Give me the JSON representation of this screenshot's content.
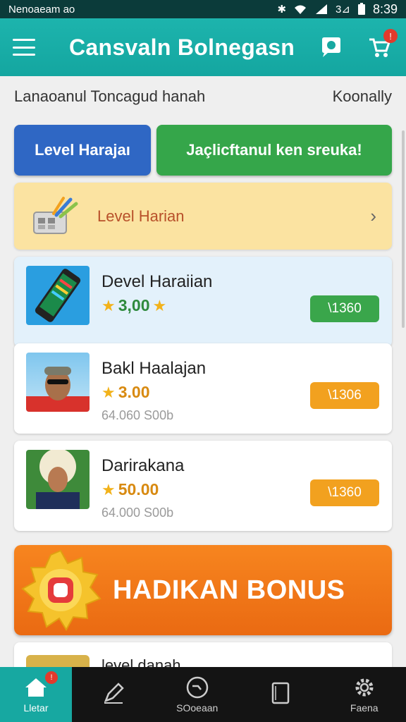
{
  "status_bar": {
    "carrier": "Nenoaeam",
    "carrier_suffix": "ao",
    "signal_label": "3⊿",
    "time": "8:39"
  },
  "app_bar": {
    "title": "Cansvaln Bolnegasn",
    "cart_badge": "!"
  },
  "subheader": {
    "left": "Lanaoanul Toncagud hanah",
    "right": "Koonally"
  },
  "buttons": {
    "blue": "Level Harajaı",
    "green": "Jaçlicftanul ken sreuka!"
  },
  "level_row": {
    "label": "Level Harian"
  },
  "cards": [
    {
      "title": "Devel Haraiian",
      "rating": "3,00",
      "price": "\\1360",
      "sub": "",
      "style": "highlight"
    },
    {
      "title": "Bakl Haalajan",
      "rating": "3.00",
      "price": "\\1306",
      "sub": "64.060 S00b"
    },
    {
      "title": "Darirakana",
      "rating": "50.00",
      "price": "\\1360",
      "sub": "64.000 S00b"
    }
  ],
  "bonus": {
    "text": "HADIKAN BONUS"
  },
  "partial_card": {
    "title": "level danah"
  },
  "bottom_nav": [
    {
      "label": "Lletar",
      "icon": "home-icon",
      "badge": "!"
    },
    {
      "label": "",
      "icon": "edit-icon"
    },
    {
      "label": "SOoeaan",
      "icon": "clock-icon"
    },
    {
      "label": "",
      "icon": "tablet-icon"
    },
    {
      "label": "Faena",
      "icon": "gear-icon"
    }
  ],
  "colors": {
    "teal": "#17a8a1",
    "blue": "#2f67c4",
    "green": "#35a64a",
    "orange": "#f2a11f",
    "bonus": "#ea6a12"
  }
}
